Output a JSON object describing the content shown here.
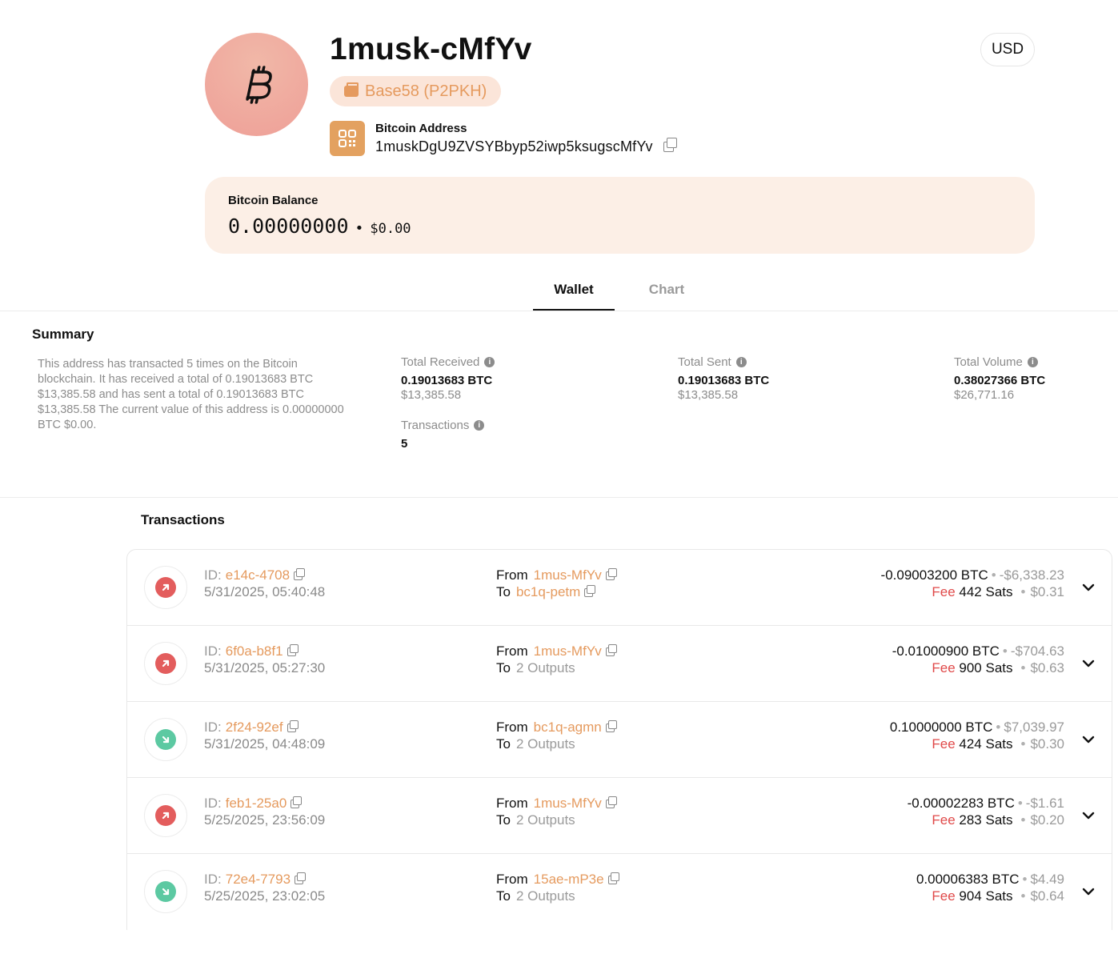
{
  "header": {
    "title": "1musk-cMfYv",
    "badge": "Base58 (P2PKH)",
    "currency": "USD",
    "address_label": "Bitcoin Address",
    "address": "1muskDgU9ZVSYBbyp52iwp5ksugscMfYv"
  },
  "balance": {
    "label": "Bitcoin Balance",
    "btc": "0.00000000",
    "separator": "•",
    "usd": "$0.00"
  },
  "tabs": [
    {
      "label": "Wallet",
      "active": true
    },
    {
      "label": "Chart",
      "active": false
    }
  ],
  "summary": {
    "title": "Summary",
    "text": "This address has transacted 5 times on the Bitcoin blockchain. It has received a total of 0.19013683 BTC $13,385.58 and has sent a total of 0.19013683 BTC $13,385.58 The current value of this address is 0.00000000 BTC $0.00.",
    "total_received": {
      "label": "Total Received",
      "btc": "0.19013683 BTC",
      "usd": "$13,385.58"
    },
    "total_sent": {
      "label": "Total Sent",
      "btc": "0.19013683 BTC",
      "usd": "$13,385.58"
    },
    "total_volume": {
      "label": "Total Volume",
      "btc": "0.38027366 BTC",
      "usd": "$26,771.16"
    },
    "transactions": {
      "label": "Transactions",
      "value": "5"
    }
  },
  "transactions": {
    "title": "Transactions",
    "id_label": "ID:",
    "from_label": "From",
    "to_label": "To",
    "fee_label": "Fee",
    "dot": "•",
    "rows": [
      {
        "direction": "out",
        "id": "e14c-4708",
        "time": "5/31/2025, 05:40:48",
        "from": "1mus-MfYv",
        "to": "bc1q-petm",
        "to_is_link": true,
        "btc": "-0.09003200 BTC",
        "usd": "-$6,338.23",
        "fee_sats": "442 Sats",
        "fee_usd": "$0.31"
      },
      {
        "direction": "out",
        "id": "6f0a-b8f1",
        "time": "5/31/2025, 05:27:30",
        "from": "1mus-MfYv",
        "to": "2 Outputs",
        "to_is_link": false,
        "btc": "-0.01000900 BTC",
        "usd": "-$704.63",
        "fee_sats": "900 Sats",
        "fee_usd": "$0.63"
      },
      {
        "direction": "in",
        "id": "2f24-92ef",
        "time": "5/31/2025, 04:48:09",
        "from": "bc1q-agmn",
        "to": "2 Outputs",
        "to_is_link": false,
        "btc": "0.10000000 BTC",
        "usd": "$7,039.97",
        "fee_sats": "424 Sats",
        "fee_usd": "$0.30"
      },
      {
        "direction": "out",
        "id": "feb1-25a0",
        "time": "5/25/2025, 23:56:09",
        "from": "1mus-MfYv",
        "to": "2 Outputs",
        "to_is_link": false,
        "btc": "-0.00002283 BTC",
        "usd": "-$1.61",
        "fee_sats": "283 Sats",
        "fee_usd": "$0.20"
      },
      {
        "direction": "in",
        "id": "72e4-7793",
        "time": "5/25/2025, 23:02:05",
        "from": "15ae-mP3e",
        "to": "2 Outputs",
        "to_is_link": false,
        "btc": "0.00006383 BTC",
        "usd": "$4.49",
        "fee_sats": "904 Sats",
        "fee_usd": "$0.64"
      }
    ]
  },
  "colors": {
    "accent": "#e59a5e",
    "fee": "#e04a4a",
    "out": "#e35d5d",
    "in": "#5cc9a2"
  },
  "icons": [
    "bitcoin-icon",
    "wallet-icon",
    "qr-code-icon",
    "copy-icon",
    "info-icon",
    "arrow-up-right-icon",
    "arrow-down-right-icon",
    "chevron-down-icon"
  ]
}
